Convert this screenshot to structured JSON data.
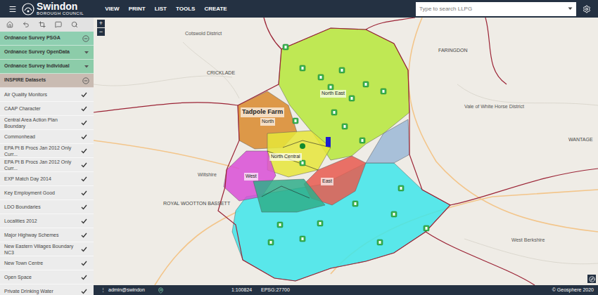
{
  "header": {
    "logo": {
      "name": "Swindon",
      "subtitle": "BOROUGH COUNCIL"
    },
    "menu": [
      "VIEW",
      "PRINT",
      "LIST",
      "TOOLS",
      "CREATE"
    ],
    "search": {
      "placeholder": "Type to search LLPG"
    }
  },
  "sidebar": {
    "sections": [
      {
        "label": "Ordnance Survey PSGA",
        "expanded": true,
        "color": "#8fcfb1"
      },
      {
        "label": "Ordnance Survey OpenData",
        "expanded": false,
        "color": "#8ccca9"
      },
      {
        "label": "Ordnance Survey Individual",
        "expanded": false,
        "color": "#8ccca9"
      },
      {
        "label": "INSPIRE Datasets",
        "expanded": true,
        "color": "#c9bbb2"
      }
    ],
    "items": [
      {
        "label": "Air Quality Monitors",
        "checked": true
      },
      {
        "label": "CAAP Character",
        "checked": true
      },
      {
        "label": "Central Area Action Plan Boundary",
        "checked": true
      },
      {
        "label": "Commonhead",
        "checked": true
      },
      {
        "label": "EPA Pt B Procs Jan 2012 Only Curr...",
        "checked": true
      },
      {
        "label": "EPA Pt B Procs Jan 2012 Only Curr...",
        "checked": true
      },
      {
        "label": "EXP Match Day 2014",
        "checked": true
      },
      {
        "label": "Key Employment Good",
        "checked": true
      },
      {
        "label": "LDO Boundaries",
        "checked": true
      },
      {
        "label": "Localities 2012",
        "checked": true
      },
      {
        "label": "Major Highway Schemes",
        "checked": true
      },
      {
        "label": "New Eastern Villages Boundary NC3",
        "checked": true
      },
      {
        "label": "New Town Centre",
        "checked": true
      },
      {
        "label": "Open Space",
        "checked": true
      },
      {
        "label": "Private Drinking Water",
        "checked": true
      }
    ]
  },
  "map": {
    "zoom": [
      "+",
      "−"
    ],
    "areas": [
      {
        "color": "#3ee6ea"
      },
      {
        "color": "#b6e83a"
      },
      {
        "color": "#d98a2b"
      },
      {
        "color": "#e6e63a"
      },
      {
        "color": "#d94fd6"
      },
      {
        "color": "#e85a4f"
      },
      {
        "color": "#2fae8a"
      },
      {
        "color": "#9bb8d6"
      }
    ],
    "labels": [
      {
        "text": "Cotswold District",
        "kind": "district"
      },
      {
        "text": "CRICKLADE",
        "kind": "town"
      },
      {
        "text": "FARINGDON",
        "kind": "town"
      },
      {
        "text": "Vale of White Horse District",
        "kind": "district"
      },
      {
        "text": "WANTAGE",
        "kind": "town"
      },
      {
        "text": "Wiltshire",
        "kind": "district"
      },
      {
        "text": "ROYAL WOOTTON BASSETT",
        "kind": "town"
      },
      {
        "text": "West Berkshire",
        "kind": "district"
      },
      {
        "text": "Tadpole Farm",
        "kind": "area"
      },
      {
        "text": "North East",
        "kind": "region"
      },
      {
        "text": "North",
        "kind": "region"
      },
      {
        "text": "North Central",
        "kind": "region"
      },
      {
        "text": "West",
        "kind": "region"
      },
      {
        "text": "East",
        "kind": "region"
      }
    ]
  },
  "status_bar": {
    "menu": "⋮",
    "user": "admin@swindon",
    "scale": "1:100824",
    "projection": "EPSG:27700",
    "copyright": "© Geosphere 2020"
  }
}
